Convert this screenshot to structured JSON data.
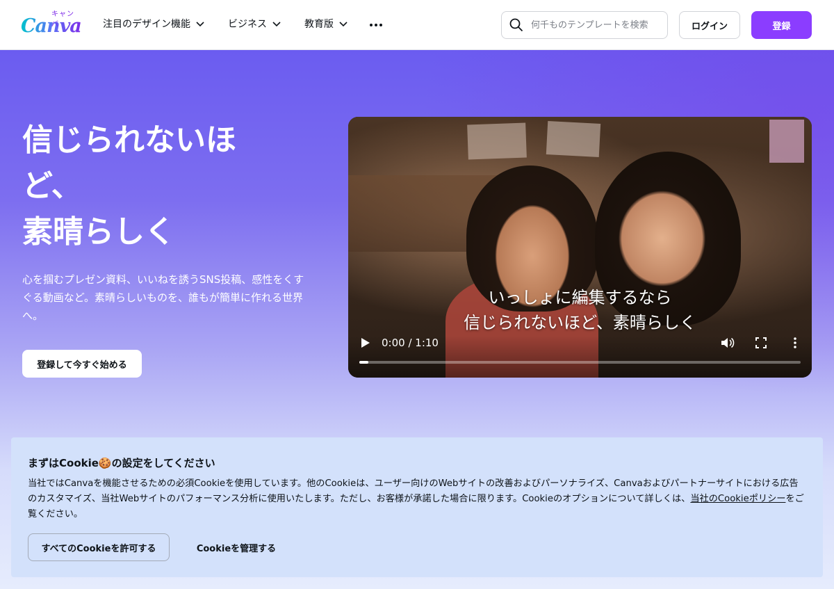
{
  "header": {
    "logo_word": "Canva",
    "logo_kana": "キャンバ",
    "nav": [
      {
        "label": "注目のデザイン機能"
      },
      {
        "label": "ビジネス"
      },
      {
        "label": "教育版"
      }
    ],
    "search_placeholder": "何千ものテンプレートを検索",
    "login_label": "ログイン",
    "signup_label": "登録"
  },
  "hero": {
    "headline": "信じられないほど、\n素晴らしく",
    "subtext": "心を掴むプレゼン資料、いいねを誘うSNS投稿、感性をくすぐる動画など。素晴らしいものを、誰もが簡単に作れる世界へ。",
    "cta_label": "登録して今すぐ始める"
  },
  "video": {
    "caption_line1": "いっしょに編集するなら",
    "caption_line2": "信じられないほど、素晴らしく",
    "time": "0:00 / 1:10",
    "progress": 0.02
  },
  "cookie": {
    "title": "まずはCookie🍪の設定をしてください",
    "body_text": "当社ではCanvaを機能させるための必須Cookieを使用しています。他のCookieは、ユーザー向けのWebサイトの改善およびパーソナライズ、Canvaおよびパートナーサイトにおける広告のカスタマイズ、当社Webサイトのパフォーマンス分析に使用いたします。ただし、お客様が承諾した場合に限ります。Cookieのオプションについて詳しくは、",
    "policy_link": "当社のCookieポリシー",
    "body_suffix": "をご覧ください。",
    "allow_label": "すべてのCookieを許可する",
    "manage_label": "Cookieを管理する"
  },
  "colors": {
    "brand_purple": "#8b3dff",
    "cookie_bg": "#d3e1fb"
  },
  "icons": [
    "search-icon",
    "chevron-down-icon",
    "more-icon",
    "play-icon",
    "volume-icon",
    "fullscreen-icon",
    "kebab-menu-icon"
  ]
}
